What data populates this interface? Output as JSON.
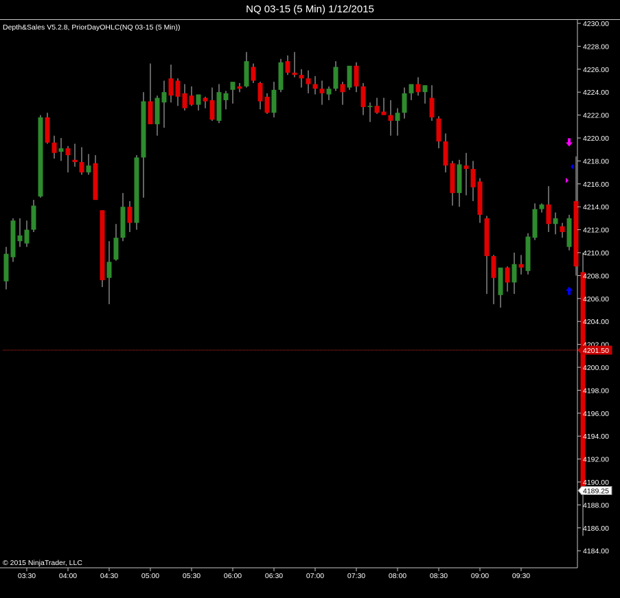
{
  "window": {
    "title": "NQ 03-15 (5 Min)  1/12/2015"
  },
  "chart_header": {
    "indicators": "Depth&Sales V5.2.8, PriorDayOHLC(NQ 03-15 (5 Min))",
    "copyright": "© 2015 NinjaTrader, LLC"
  },
  "colors": {
    "background": "#000000",
    "up_candle": "#2e8b2e",
    "down_candle": "#e00000",
    "wick": "#c8c8c8",
    "prior_day_line": "#ff3030",
    "marker_down": "#ff00ff",
    "marker_up": "#0000ff"
  },
  "chart_data": {
    "type": "candlestick",
    "symbol": "NQ 03-15",
    "interval": "5 Min",
    "date": "1/12/2015",
    "ylim": [
      4183,
      4231
    ],
    "y_ticks": [
      "4230.00",
      "4228.00",
      "4226.00",
      "4224.00",
      "4222.00",
      "4220.00",
      "4218.00",
      "4216.00",
      "4214.00",
      "4212.00",
      "4210.00",
      "4208.00",
      "4206.00",
      "4204.00",
      "4202.00",
      "4200.00",
      "4198.00",
      "4196.00",
      "4194.00",
      "4192.00",
      "4190.00",
      "4188.00",
      "4186.00",
      "4184.00"
    ],
    "x_ticks": [
      {
        "label": "03:30",
        "bar": 3
      },
      {
        "label": "04:00",
        "bar": 9
      },
      {
        "label": "04:30",
        "bar": 15
      },
      {
        "label": "05:00",
        "bar": 21
      },
      {
        "label": "05:30",
        "bar": 27
      },
      {
        "label": "06:00",
        "bar": 33
      },
      {
        "label": "06:30",
        "bar": 39
      },
      {
        "label": "07:00",
        "bar": 45
      },
      {
        "label": "07:30",
        "bar": 51
      },
      {
        "label": "08:00",
        "bar": 57
      },
      {
        "label": "08:30",
        "bar": 63
      },
      {
        "label": "09:00",
        "bar": 69
      },
      {
        "label": "09:30",
        "bar": 75
      }
    ],
    "candles": [
      {
        "o": 4207.5,
        "h": 4210.5,
        "l": 4206.8,
        "c": 4209.9
      },
      {
        "o": 4209.6,
        "h": 4213.0,
        "l": 4209.2,
        "c": 4212.8
      },
      {
        "o": 4211.0,
        "h": 4213.0,
        "l": 4210.5,
        "c": 4211.5
      },
      {
        "o": 4210.8,
        "h": 4212.8,
        "l": 4210.5,
        "c": 4212.0
      },
      {
        "o": 4212.0,
        "h": 4214.6,
        "l": 4211.8,
        "c": 4214.1
      },
      {
        "o": 4214.9,
        "h": 4222.0,
        "l": 4214.8,
        "c": 4221.8
      },
      {
        "o": 4221.8,
        "h": 4222.2,
        "l": 4219.5,
        "c": 4219.6
      },
      {
        "o": 4219.6,
        "h": 4220.2,
        "l": 4218.2,
        "c": 4218.7
      },
      {
        "o": 4218.8,
        "h": 4220.0,
        "l": 4218.0,
        "c": 4219.1
      },
      {
        "o": 4219.1,
        "h": 4219.3,
        "l": 4217.0,
        "c": 4218.5
      },
      {
        "o": 4218.1,
        "h": 4219.5,
        "l": 4217.5,
        "c": 4217.9
      },
      {
        "o": 4217.9,
        "h": 4219.2,
        "l": 4216.8,
        "c": 4217.0
      },
      {
        "o": 4217.0,
        "h": 4218.6,
        "l": 4216.8,
        "c": 4217.6
      },
      {
        "o": 4217.8,
        "h": 4218.5,
        "l": 4215.5,
        "c": 4214.6
      },
      {
        "o": 4213.7,
        "h": 4213.7,
        "l": 4207.0,
        "c": 4207.6
      },
      {
        "o": 4207.8,
        "h": 4211.0,
        "l": 4205.5,
        "c": 4209.2
      },
      {
        "o": 4209.4,
        "h": 4212.5,
        "l": 4209.3,
        "c": 4211.3
      },
      {
        "o": 4211.3,
        "h": 4215.2,
        "l": 4211.0,
        "c": 4214.0
      },
      {
        "o": 4214.0,
        "h": 4214.5,
        "l": 4211.8,
        "c": 4212.6
      },
      {
        "o": 4212.6,
        "h": 4218.5,
        "l": 4212.0,
        "c": 4218.3
      },
      {
        "o": 4218.3,
        "h": 4224.0,
        "l": 4214.8,
        "c": 4223.2
      },
      {
        "o": 4223.2,
        "h": 4226.5,
        "l": 4221.7,
        "c": 4221.2
      },
      {
        "o": 4221.2,
        "h": 4223.7,
        "l": 4220.2,
        "c": 4223.5
      },
      {
        "o": 4223.1,
        "h": 4225.0,
        "l": 4220.9,
        "c": 4224.0
      },
      {
        "o": 4225.2,
        "h": 4226.4,
        "l": 4223.1,
        "c": 4223.7
      },
      {
        "o": 4225.0,
        "h": 4225.2,
        "l": 4222.8,
        "c": 4223.6
      },
      {
        "o": 4223.9,
        "h": 4224.7,
        "l": 4222.4,
        "c": 4222.6
      },
      {
        "o": 4223.7,
        "h": 4224.5,
        "l": 4222.8,
        "c": 4222.9
      },
      {
        "o": 4222.9,
        "h": 4223.8,
        "l": 4222.4,
        "c": 4223.8
      },
      {
        "o": 4223.5,
        "h": 4223.6,
        "l": 4222.6,
        "c": 4223.2
      },
      {
        "o": 4223.3,
        "h": 4224.4,
        "l": 4221.5,
        "c": 4221.6
      },
      {
        "o": 4221.5,
        "h": 4224.7,
        "l": 4221.3,
        "c": 4224.0
      },
      {
        "o": 4223.3,
        "h": 4224.1,
        "l": 4222.5,
        "c": 4223.9
      },
      {
        "o": 4224.2,
        "h": 4224.8,
        "l": 4223.0,
        "c": 4224.9
      },
      {
        "o": 4224.5,
        "h": 4224.8,
        "l": 4224.0,
        "c": 4224.3
      },
      {
        "o": 4224.5,
        "h": 4227.5,
        "l": 4224.4,
        "c": 4226.7
      },
      {
        "o": 4226.2,
        "h": 4226.5,
        "l": 4224.8,
        "c": 4225.0
      },
      {
        "o": 4224.8,
        "h": 4224.9,
        "l": 4222.5,
        "c": 4223.2
      },
      {
        "o": 4223.6,
        "h": 4223.9,
        "l": 4222.1,
        "c": 4222.2
      },
      {
        "o": 4222.2,
        "h": 4224.9,
        "l": 4221.8,
        "c": 4224.2
      },
      {
        "o": 4224.2,
        "h": 4226.9,
        "l": 4224.0,
        "c": 4226.6
      },
      {
        "o": 4226.7,
        "h": 4227.2,
        "l": 4225.5,
        "c": 4225.7
      },
      {
        "o": 4225.7,
        "h": 4227.5,
        "l": 4225.3,
        "c": 4225.5
      },
      {
        "o": 4225.5,
        "h": 4226.0,
        "l": 4224.4,
        "c": 4225.2
      },
      {
        "o": 4225.2,
        "h": 4225.9,
        "l": 4223.9,
        "c": 4224.7
      },
      {
        "o": 4224.7,
        "h": 4225.4,
        "l": 4223.8,
        "c": 4224.3
      },
      {
        "o": 4224.3,
        "h": 4225.0,
        "l": 4222.9,
        "c": 4223.9
      },
      {
        "o": 4223.8,
        "h": 4224.5,
        "l": 4223.3,
        "c": 4224.3
      },
      {
        "o": 4224.3,
        "h": 4226.7,
        "l": 4224.1,
        "c": 4226.2
      },
      {
        "o": 4224.7,
        "h": 4224.9,
        "l": 4222.9,
        "c": 4224.0
      },
      {
        "o": 4224.4,
        "h": 4225.9,
        "l": 4224.2,
        "c": 4226.3
      },
      {
        "o": 4226.3,
        "h": 4226.6,
        "l": 4224.0,
        "c": 4224.5
      },
      {
        "o": 4224.5,
        "h": 4224.8,
        "l": 4222.0,
        "c": 4222.7
      },
      {
        "o": 4222.7,
        "h": 4223.1,
        "l": 4221.4,
        "c": 4222.8
      },
      {
        "o": 4222.8,
        "h": 4223.5,
        "l": 4222.1,
        "c": 4222.2
      },
      {
        "o": 4222.3,
        "h": 4223.5,
        "l": 4222.0,
        "c": 4222.0
      },
      {
        "o": 4222.0,
        "h": 4223.3,
        "l": 4220.2,
        "c": 4221.5
      },
      {
        "o": 4221.5,
        "h": 4222.6,
        "l": 4220.2,
        "c": 4222.2
      },
      {
        "o": 4222.2,
        "h": 4224.4,
        "l": 4221.7,
        "c": 4223.9
      },
      {
        "o": 4223.9,
        "h": 4224.5,
        "l": 4223.3,
        "c": 4224.7
      },
      {
        "o": 4224.7,
        "h": 4225.3,
        "l": 4223.7,
        "c": 4224.0
      },
      {
        "o": 4224.0,
        "h": 4224.6,
        "l": 4223.0,
        "c": 4224.6
      },
      {
        "o": 4223.5,
        "h": 4224.6,
        "l": 4221.5,
        "c": 4221.8
      },
      {
        "o": 4221.7,
        "h": 4221.9,
        "l": 4219.1,
        "c": 4219.7
      },
      {
        "o": 4219.7,
        "h": 4220.4,
        "l": 4217.0,
        "c": 4217.6
      },
      {
        "o": 4217.8,
        "h": 4218.0,
        "l": 4214.1,
        "c": 4215.2
      },
      {
        "o": 4215.2,
        "h": 4218.1,
        "l": 4214.0,
        "c": 4217.7
      },
      {
        "o": 4217.6,
        "h": 4218.7,
        "l": 4215.0,
        "c": 4217.3
      },
      {
        "o": 4217.3,
        "h": 4218.0,
        "l": 4214.5,
        "c": 4215.7
      },
      {
        "o": 4216.2,
        "h": 4216.5,
        "l": 4212.6,
        "c": 4213.3
      },
      {
        "o": 4213.0,
        "h": 4213.2,
        "l": 4206.4,
        "c": 4209.7
      },
      {
        "o": 4209.7,
        "h": 4209.8,
        "l": 4205.5,
        "c": 4207.8
      },
      {
        "o": 4206.3,
        "h": 4208.5,
        "l": 4205.2,
        "c": 4208.7
      },
      {
        "o": 4208.7,
        "h": 4208.8,
        "l": 4206.6,
        "c": 4207.4
      },
      {
        "o": 4207.4,
        "h": 4210.0,
        "l": 4206.4,
        "c": 4209.0
      },
      {
        "o": 4209.0,
        "h": 4209.8,
        "l": 4208.1,
        "c": 4208.7
      },
      {
        "o": 4208.4,
        "h": 4211.7,
        "l": 4208.1,
        "c": 4211.4
      },
      {
        "o": 4211.3,
        "h": 4214.3,
        "l": 4211.1,
        "c": 4213.8
      },
      {
        "o": 4213.8,
        "h": 4214.3,
        "l": 4213.5,
        "c": 4214.2
      },
      {
        "o": 4214.2,
        "h": 4215.8,
        "l": 4211.8,
        "c": 4212.5
      },
      {
        "o": 4212.5,
        "h": 4213.5,
        "l": 4211.6,
        "c": 4213.0
      },
      {
        "o": 4212.3,
        "h": 4212.6,
        "l": 4211.3,
        "c": 4211.8
      },
      {
        "o": 4210.5,
        "h": 4213.3,
        "l": 4210.2,
        "c": 4213.0
      },
      {
        "o": 4214.5,
        "h": 4218.4,
        "l": 4208.0,
        "c": 4208.8
      },
      {
        "o": 4208.3,
        "h": 4210.0,
        "l": 4185.3,
        "c": 4189.25
      }
    ],
    "prior_day_level": {
      "value": 4201.5,
      "label": "4201.50"
    },
    "last_price": {
      "value": 4189.25,
      "label": "4189.25"
    },
    "markers": [
      {
        "bar": 82,
        "price": 4219.5,
        "kind": "arrow-down",
        "color": "#ff00ff"
      },
      {
        "bar": 82,
        "price": 4216.3,
        "kind": "triangle-right",
        "color": "#ff00ff"
      },
      {
        "bar": 82,
        "price": 4217.5,
        "kind": "triangle-left",
        "color": "#0000ff"
      },
      {
        "bar": 82,
        "price": 4206.8,
        "kind": "arrow-up",
        "color": "#0000ff"
      }
    ]
  }
}
